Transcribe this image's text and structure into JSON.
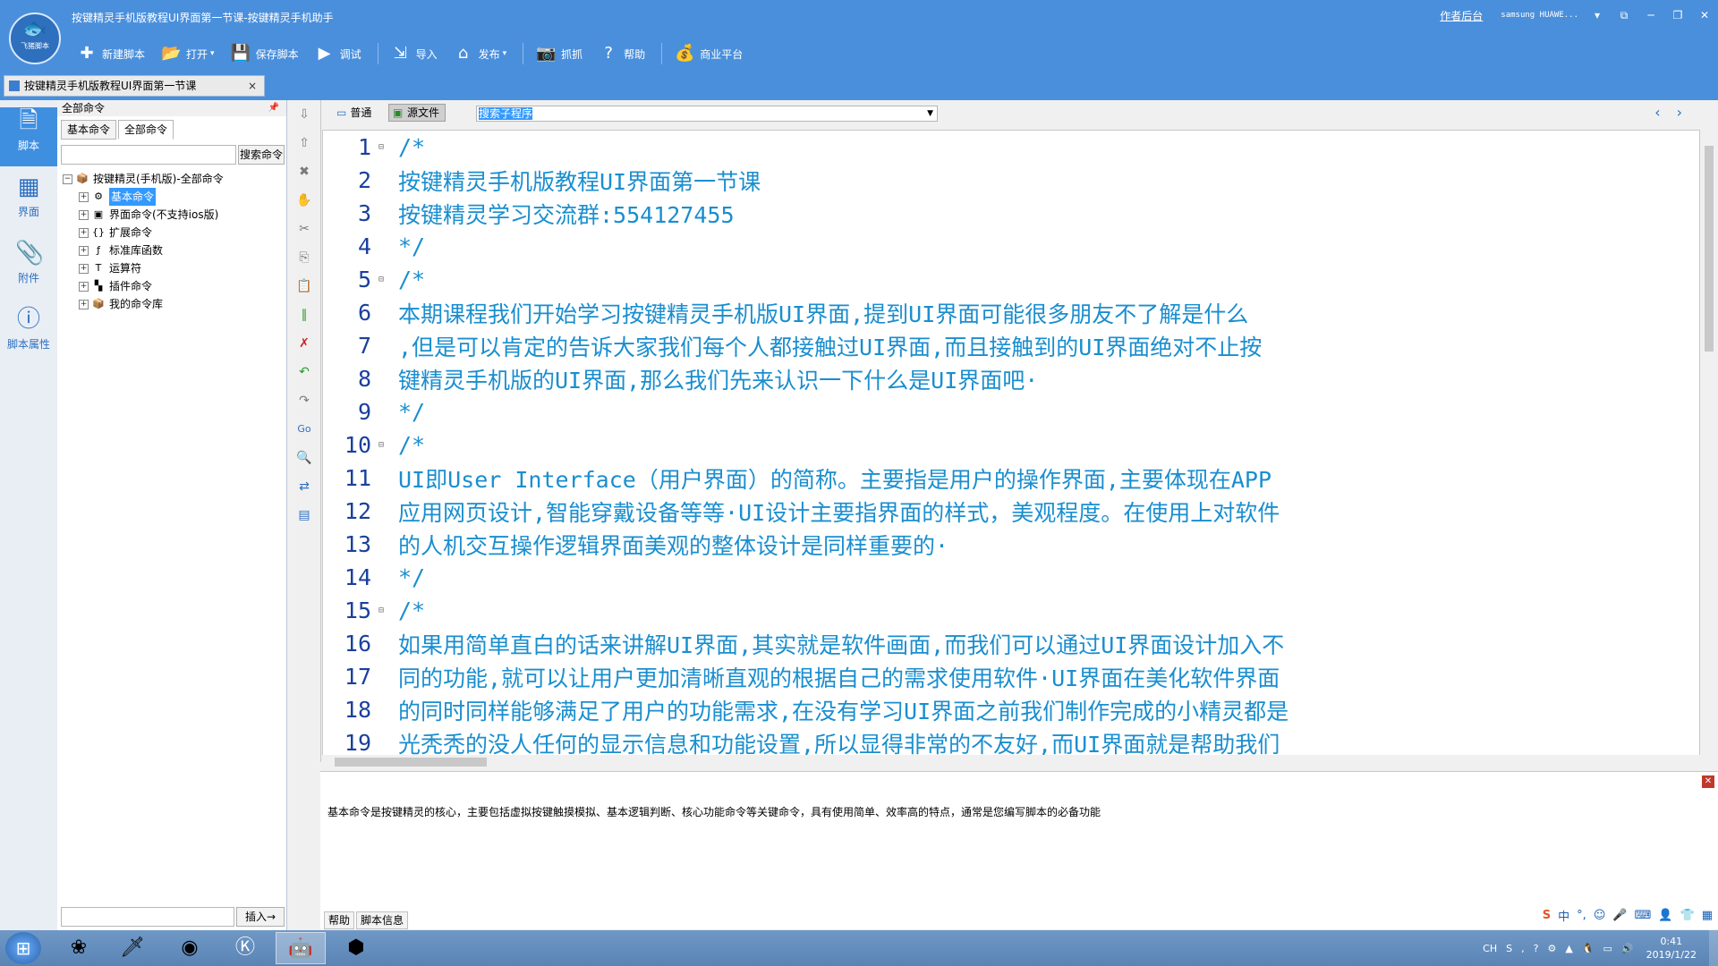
{
  "app": {
    "window_title": "按键精灵手机版教程UI界面第一节课-按键精灵手机助手",
    "logo_text": "飞猪脚本",
    "right_links": {
      "author": "作者后台",
      "device": "samsung  HUAWE..."
    }
  },
  "toolbar": {
    "new_script": "新建脚本",
    "open": "打开",
    "save": "保存脚本",
    "debug": "调试",
    "import": "导入",
    "publish": "发布",
    "capture": "抓抓",
    "help": "帮助",
    "business": "商业平台"
  },
  "doc_tab": {
    "label": "按键精灵手机版教程UI界面第一节课",
    "close": "×"
  },
  "left_nav": [
    {
      "label": "脚本",
      "icon": "script-icon"
    },
    {
      "label": "界面",
      "icon": "grid-icon"
    },
    {
      "label": "附件",
      "icon": "attachment-icon"
    },
    {
      "label": "脚本属性",
      "icon": "info-icon"
    }
  ],
  "command_panel": {
    "header": "全部命令",
    "tabs": [
      "基本命令",
      "全部命令"
    ],
    "search_button": "搜索命令",
    "insert_button": "插入→",
    "tree_root": "按键精灵(手机版)-全部命令",
    "tree_items": [
      "基本命令",
      "界面命令(不支持ios版)",
      "扩展命令",
      "标准库函数",
      "运算符",
      "插件命令",
      "我的命令库"
    ],
    "tree_item_icons": [
      "{}",
      "T"
    ]
  },
  "editor": {
    "view_normal": "普通",
    "view_source": "源文件",
    "subroutine_search": "搜索子程序",
    "lines": [
      {
        "num": "1",
        "fold": "⊟",
        "text": "/*"
      },
      {
        "num": "2",
        "fold": "",
        "text": "按键精灵手机版教程UI界面第一节课"
      },
      {
        "num": "3",
        "fold": "",
        "text": "按键精灵学习交流群:554127455"
      },
      {
        "num": "4",
        "fold": "",
        "text": "*/"
      },
      {
        "num": "5",
        "fold": "⊟",
        "text": "/*"
      },
      {
        "num": "6",
        "fold": "",
        "text": "本期课程我们开始学习按键精灵手机版UI界面,提到UI界面可能很多朋友不了解是什么"
      },
      {
        "num": "7",
        "fold": "",
        "text": ",但是可以肯定的告诉大家我们每个人都接触过UI界面,而且接触到的UI界面绝对不止按"
      },
      {
        "num": "8",
        "fold": "",
        "text": "键精灵手机版的UI界面,那么我们先来认识一下什么是UI界面吧·"
      },
      {
        "num": "9",
        "fold": "",
        "text": "*/"
      },
      {
        "num": "10",
        "fold": "⊟",
        "text": "/*"
      },
      {
        "num": "11",
        "fold": "",
        "text": "UI即User Interface（用户界面）的简称。主要指是用户的操作界面,主要体现在APP"
      },
      {
        "num": "12",
        "fold": "",
        "text": "应用网页设计,智能穿戴设备等等·UI设计主要指界面的样式，美观程度。在使用上对软件"
      },
      {
        "num": "13",
        "fold": "",
        "text": "的人机交互操作逻辑界面美观的整体设计是同样重要的·"
      },
      {
        "num": "14",
        "fold": "",
        "text": "*/"
      },
      {
        "num": "15",
        "fold": "⊟",
        "text": "/*"
      },
      {
        "num": "16",
        "fold": "",
        "text": "如果用简单直白的话来讲解UI界面,其实就是软件画面,而我们可以通过UI界面设计加入不"
      },
      {
        "num": "17",
        "fold": "",
        "text": "同的功能,就可以让用户更加清晰直观的根据自己的需求使用软件·UI界面在美化软件界面"
      },
      {
        "num": "18",
        "fold": "",
        "text": "的同时同样能够满足了用户的功能需求,在没有学习UI界面之前我们制作完成的小精灵都是"
      },
      {
        "num": "19",
        "fold": "",
        "text": "光秃秃的没人任何的显示信息和功能设置,所以显得非常的不友好,而UI界面就是帮助我们"
      }
    ]
  },
  "help_panel": {
    "text": "基本命令是按键精灵的核心，主要包括虚拟按键触摸模拟、基本逻辑判断、核心功能命令等关键命令，具有使用简单、效率高的特点，通常是您编写脚本的必备功能",
    "tabs": [
      "帮助",
      "脚本信息"
    ],
    "ime": "中"
  },
  "taskbar": {
    "lang": "CH",
    "time": "0:41",
    "date": "2019/1/22"
  },
  "colors": {
    "accent": "#4a8fdc",
    "code": "#1a8ecf",
    "line_numbers": "#1a3f9e",
    "selection": "#3399ff"
  }
}
